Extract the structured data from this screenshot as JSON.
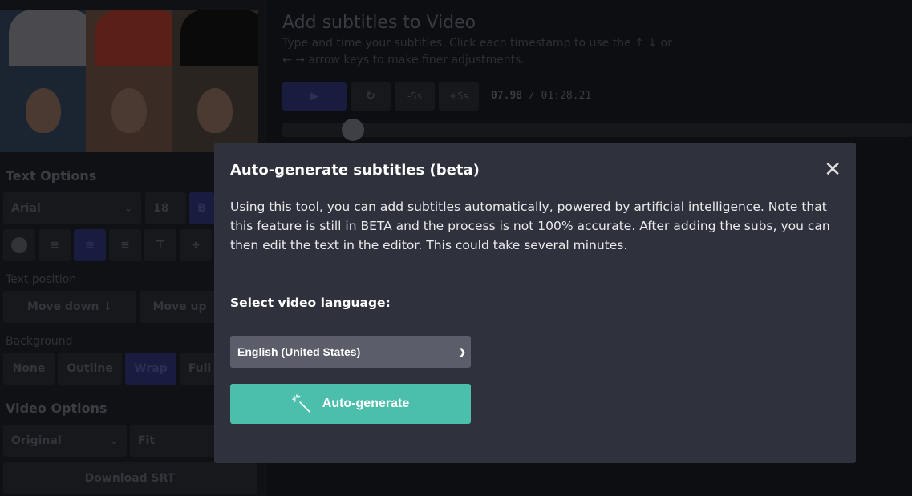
{
  "main": {
    "title": "Add subtitles to Video",
    "subtitle": "Type and time your subtitles. Click each timestamp to use the ↑ ↓ or ← → arrow keys to make finer adjustments.",
    "play": "▶",
    "restart": "↻",
    "back5": "-5s",
    "fwd5": "+5s",
    "current_time": "07.98",
    "duration": "/ 01:28.21",
    "progress_fraction": 0.09
  },
  "sidebar": {
    "text_options": "Text Options",
    "font": "Arial",
    "size": "18",
    "bold": "B",
    "text_position": "Text position",
    "move_down": "Move down ↓",
    "move_up": "Move up",
    "background": "Background",
    "bg_options": [
      "None",
      "Outline",
      "Wrap",
      "Full"
    ],
    "video_options": "Video Options",
    "ratio": "Original",
    "fit": "Fit",
    "download": "Download SRT"
  },
  "modal": {
    "title": "Auto-generate subtitles (beta)",
    "close": "✕",
    "description": "Using this tool, you can add subtitles automatically, powered by artificial intelligence. Note that this feature is still in BETA and the process is not 100% accurate. After adding the subs, you can then edit the text in the editor. This could take several minutes.",
    "select_label": "Select video language:",
    "language": "English (United States)",
    "button": "Auto-generate",
    "button_color": "#4bbfab"
  }
}
